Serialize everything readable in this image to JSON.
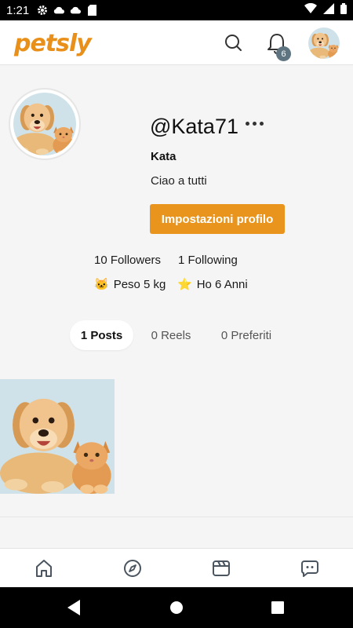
{
  "status_bar": {
    "time": "1:21",
    "left_icons": [
      "gear-icon",
      "cloud-icon",
      "cloud-upload-icon",
      "sd-card-icon"
    ],
    "right_icons": [
      "wifi-icon",
      "signal-icon",
      "battery-icon"
    ]
  },
  "header": {
    "logo": "petsly",
    "notification_count": "6",
    "icons": [
      "search-icon",
      "bell-icon"
    ]
  },
  "profile": {
    "username": "@Kata71",
    "display_name": "Kata",
    "bio": "Ciao a tutti",
    "settings_button": "Impostazioni profilo",
    "followers": "10 Followers",
    "following": "1 Following",
    "weight_emoji": "🐱",
    "weight": "Peso 5 kg",
    "age_emoji": "⭐",
    "age": "Ho 6 Anni"
  },
  "tabs": [
    {
      "label": "1 Posts",
      "active": true
    },
    {
      "label": "0 Reels",
      "active": false
    },
    {
      "label": "0 Preferiti",
      "active": false
    }
  ],
  "bottom_nav": [
    "home-icon",
    "compass-icon",
    "clapperboard-icon",
    "chat-icon"
  ],
  "colors": {
    "brand": "#e8901a",
    "button": "#e8941d",
    "badge": "#5f7481"
  }
}
